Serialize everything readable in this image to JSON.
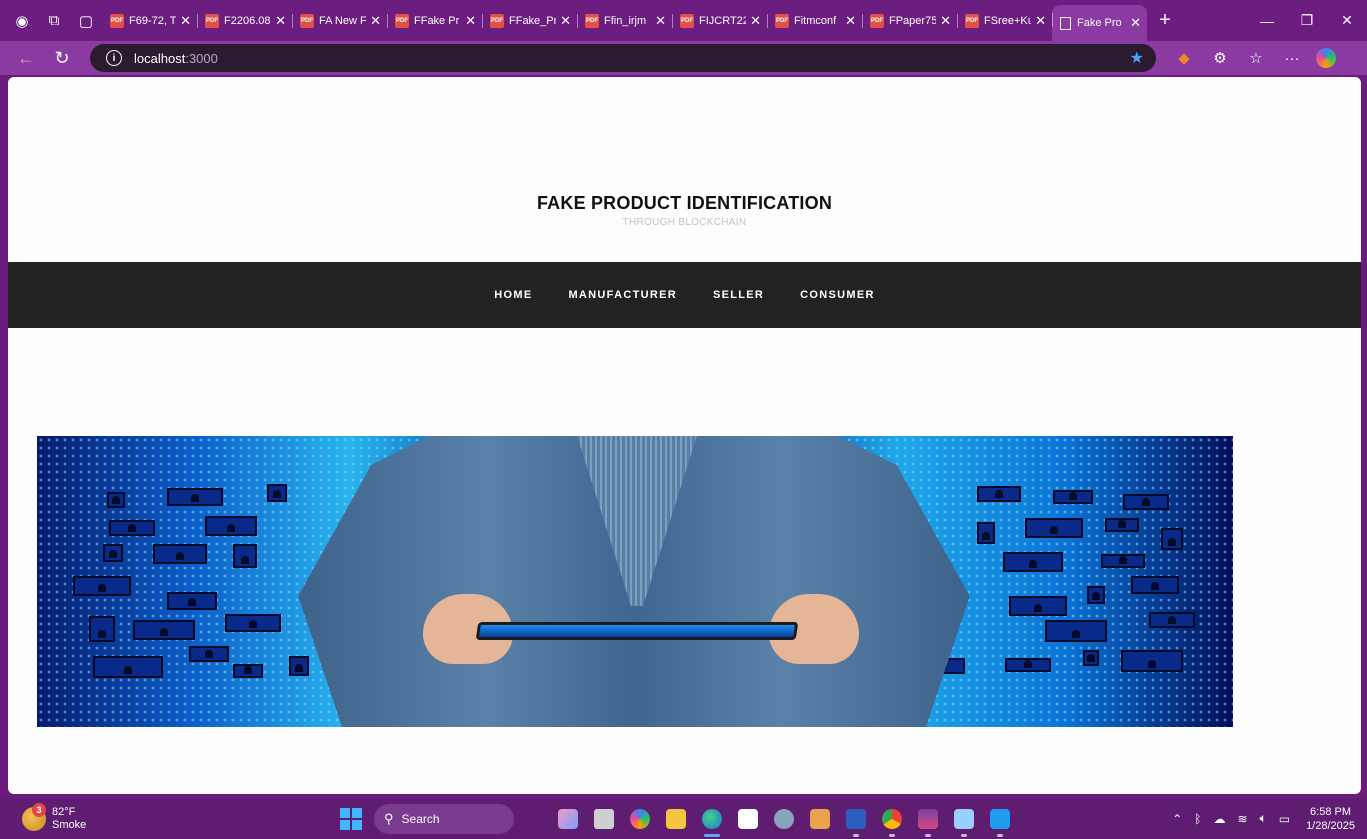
{
  "browser": {
    "tabs": [
      {
        "title": "F69-72, T",
        "type": "pdf"
      },
      {
        "title": "F2206.08",
        "type": "pdf"
      },
      {
        "title": "FA New F",
        "type": "pdf"
      },
      {
        "title": "FFake Pr",
        "type": "pdf"
      },
      {
        "title": "FFake_Pr",
        "type": "pdf"
      },
      {
        "title": "Ffin_irjm",
        "type": "pdf"
      },
      {
        "title": "FIJCRT22",
        "type": "pdf"
      },
      {
        "title": "Fitmconf",
        "type": "pdf"
      },
      {
        "title": "FPaper75",
        "type": "pdf"
      },
      {
        "title": "FSree+Ku",
        "type": "pdf"
      }
    ],
    "active_tab": {
      "title": "Fake Pro"
    },
    "address": {
      "host": "localhost",
      "port": ":3000"
    }
  },
  "page": {
    "title": "FAKE PRODUCT IDENTIFICATION",
    "subtitle": "THROUGH BLOCKCHAIN",
    "nav": [
      "HOME",
      "MANUFACTURER",
      "SELLER",
      "CONSUMER"
    ]
  },
  "taskbar": {
    "weather": {
      "temp": "82°F",
      "condition": "Smoke",
      "badge": "3"
    },
    "search_placeholder": "Search",
    "time": "6:58 PM",
    "date": "1/28/2025"
  },
  "colors": {
    "tab_strip": "#6b1d80",
    "toolbar": "#8a3aa0",
    "nav_bar": "#222222",
    "taskbar": "#5e1d70"
  }
}
